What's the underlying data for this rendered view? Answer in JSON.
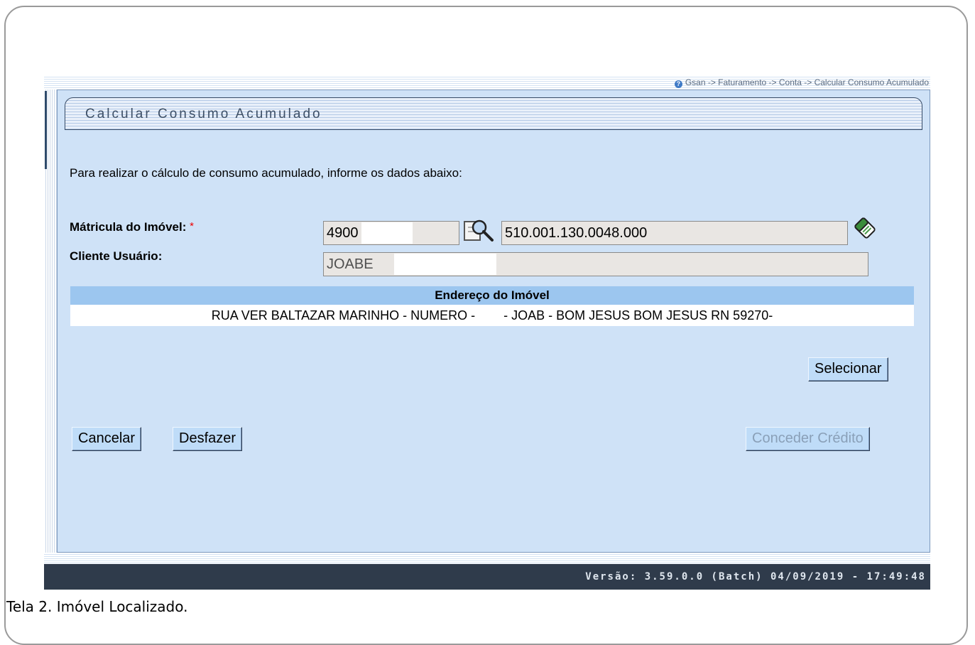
{
  "breadcrumb": "Gsan -> Faturamento -> Conta -> Calcular Consumo Acumulado",
  "page_title": "Calcular Consumo Acumulado",
  "instructions": "Para realizar o cálculo de consumo acumulado, informe os dados abaixo:",
  "form": {
    "matricula_label": "Mátricula do Imóvel:",
    "required_marker": "*",
    "matricula_value": "4900",
    "inscricao_value": "510.001.130.0048.000",
    "cliente_label": "Cliente Usuário:",
    "cliente_value": "JOABE"
  },
  "address": {
    "header": "Endereço do Imóvel",
    "value": "RUA VER BALTAZAR MARINHO - NUMERO -        - JOAB - BOM JESUS BOM JESUS RN 59270-"
  },
  "buttons": {
    "selecionar": "Selecionar",
    "cancelar": "Cancelar",
    "desfazer": "Desfazer",
    "conceder_credito": "Conceder Crédito"
  },
  "footer_version": "Versão: 3.59.0.0 (Batch) 04/09/2019 - 17:49:48",
  "caption": "Tela 2. Imóvel Localizado.",
  "icons": {
    "help": "help-icon",
    "search": "magnifier-search-icon",
    "clear": "eraser-icon"
  },
  "colors": {
    "panel_bg": "#cfe2f7",
    "address_header_bg": "#9cc6ef",
    "footer_bg": "#2f3b4b",
    "required": "#ee0000"
  }
}
